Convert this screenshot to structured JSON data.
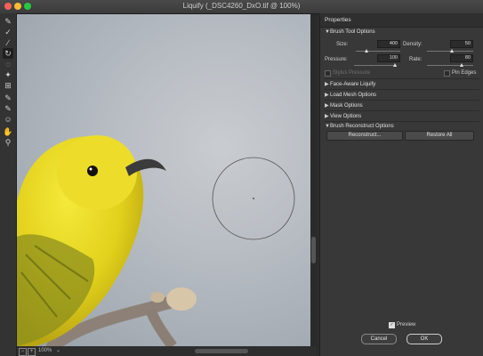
{
  "window": {
    "title": "Liquify (_DSC4260_DxO.tif @ 100%)"
  },
  "toolbar": {
    "tools": [
      {
        "icon": "forward-warp-icon",
        "glyph": "✎"
      },
      {
        "icon": "reconstruct-icon",
        "glyph": "✓"
      },
      {
        "icon": "smooth-icon",
        "glyph": "∕"
      },
      {
        "icon": "twirl-icon",
        "glyph": "↻"
      },
      {
        "icon": "pucker-icon",
        "glyph": "◌"
      },
      {
        "icon": "bloat-icon",
        "glyph": "✦"
      },
      {
        "icon": "push-left-icon",
        "glyph": "⊞"
      },
      {
        "icon": "freeze-mask-icon",
        "glyph": "✎"
      },
      {
        "icon": "thaw-mask-icon",
        "glyph": "✎"
      },
      {
        "icon": "face-tool-icon",
        "glyph": "☺"
      },
      {
        "icon": "hand-icon",
        "glyph": "✋"
      },
      {
        "icon": "zoom-icon",
        "glyph": "⚲"
      }
    ]
  },
  "status": {
    "zoom": "100%",
    "caret": "⌄",
    "minus": "−",
    "plus": "+"
  },
  "panel": {
    "title": "Properties",
    "brush_tool_options": {
      "header": "Brush Tool Options",
      "size_label": "Size:",
      "size_value": "400",
      "density_label": "Density:",
      "density_value": "50",
      "pressure_label": "Pressure:",
      "pressure_value": "100",
      "rate_label": "Rate:",
      "rate_value": "80",
      "stylus_label": "Stylus Pressure",
      "pin_edges_label": "Pin Edges"
    },
    "sections": [
      "Face-Aware Liquify",
      "Load Mesh Options",
      "Mask Options",
      "View Options"
    ],
    "reconstruct": {
      "header": "Brush Reconstruct Options",
      "reconstruct_btn": "Reconstruct...",
      "restore_btn": "Restore All"
    },
    "preview_label": "Preview",
    "check_mark": "✓",
    "cancel_btn": "Cancel",
    "ok_btn": "OK"
  }
}
